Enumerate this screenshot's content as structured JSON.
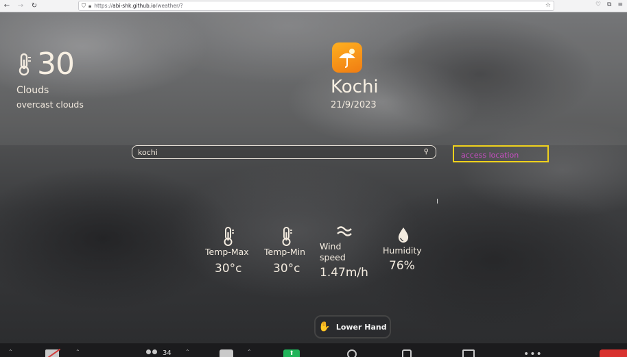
{
  "browser": {
    "url_scheme": "https://",
    "url_host": "abi-shk.github.io",
    "url_path": "/weather/?"
  },
  "weather": {
    "temperature": "30",
    "condition": "Clouds",
    "description": "overcast clouds",
    "city": "Kochi",
    "date": "21/9/2023"
  },
  "search": {
    "value": "kochi"
  },
  "location_button": {
    "label": "access location"
  },
  "stats": {
    "temp_max": {
      "label": "Temp-Max",
      "value": "30°c"
    },
    "temp_min": {
      "label": "Temp-Min",
      "value": "30°c"
    },
    "wind": {
      "label_line1": "Wind",
      "label_line2": "speed",
      "value": "1.47m/h"
    },
    "humidity": {
      "label": "Humidity",
      "value": "76%"
    }
  },
  "zoom": {
    "lower_hand_label": "Lower Hand",
    "participants_count": "34"
  },
  "colors": {
    "accent_border": "#f0d21c",
    "location_text": "#c84fc4",
    "app_icon": "#f5a01a"
  },
  "icons": {
    "thermometer": "thermometer-icon",
    "umbrella": "umbrella-sun-icon",
    "wind": "wind-icon",
    "humidity": "droplet-icon",
    "search": "search-icon"
  }
}
